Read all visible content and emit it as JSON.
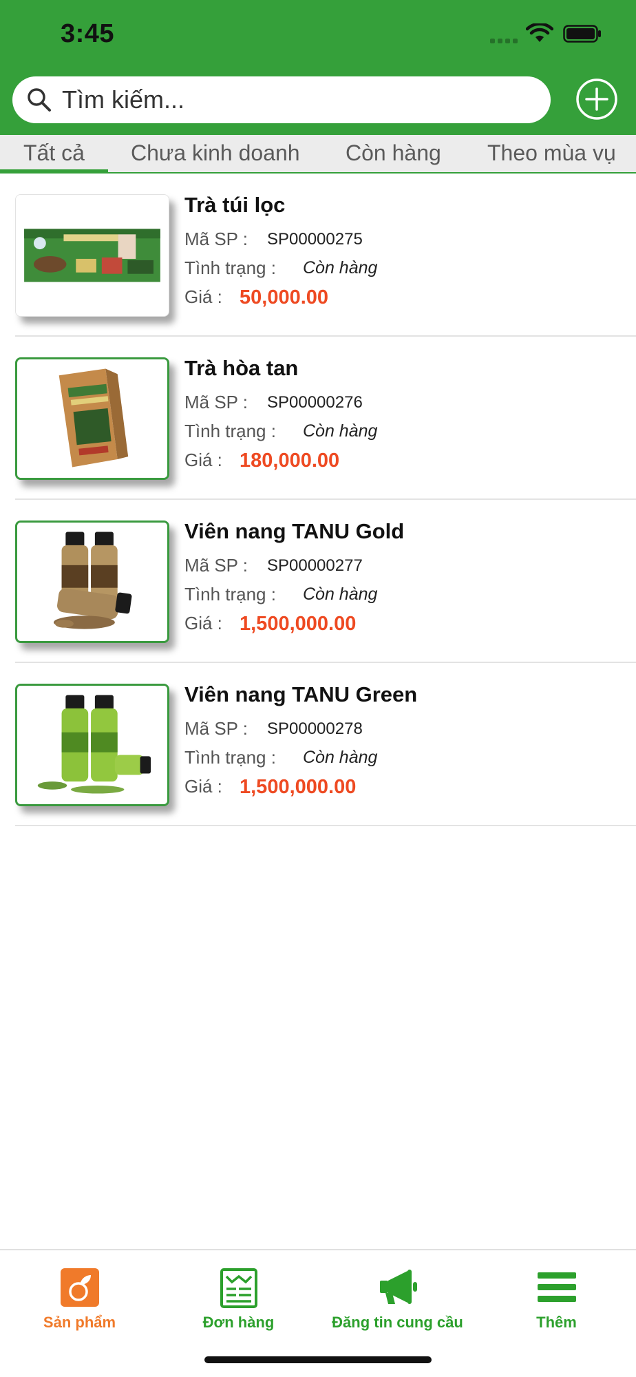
{
  "status_bar": {
    "time": "3:45"
  },
  "search": {
    "placeholder": "Tìm kiếm..."
  },
  "header": {
    "add_icon": "plus-circle-icon",
    "accent_color": "#35a03a"
  },
  "tabs": [
    {
      "label": "Tất cả",
      "active": true
    },
    {
      "label": "Chưa kinh doanh",
      "active": false
    },
    {
      "label": "Còn hàng",
      "active": false
    },
    {
      "label": "Theo mùa vụ",
      "active": false
    }
  ],
  "field_labels": {
    "code": "Mã SP :",
    "status": "Tình trạng :",
    "price": "Giá :"
  },
  "products": [
    {
      "name": "Trà túi lọc",
      "code": "SP00000275",
      "status": "Còn hàng",
      "price": "50,000.00",
      "image": "tea-bag-box"
    },
    {
      "name": "Trà hòa tan",
      "code": "SP00000276",
      "status": "Còn hàng",
      "price": "180,000.00",
      "image": "instant-tea-box"
    },
    {
      "name": "Viên nang TANU Gold",
      "code": "SP00000277",
      "status": "Còn hàng",
      "price": "1,500,000.00",
      "image": "gold-capsule-bottles"
    },
    {
      "name": "Viên nang TANU Green",
      "code": "SP00000278",
      "status": "Còn hàng",
      "price": "1,500,000.00",
      "image": "green-capsule-bottles"
    }
  ],
  "bottom_nav": [
    {
      "label": "Sản phẩm",
      "icon": "product-leaf-icon",
      "active": true
    },
    {
      "label": "Đơn hàng",
      "icon": "order-list-icon",
      "active": false
    },
    {
      "label": "Đăng tin cung cầu",
      "icon": "megaphone-icon",
      "active": false
    },
    {
      "label": "Thêm",
      "icon": "menu-icon",
      "active": false
    }
  ],
  "colors": {
    "price": "#ee4a22",
    "nav_active": "#f07a2a",
    "nav_inactive": "#2ca02c"
  }
}
